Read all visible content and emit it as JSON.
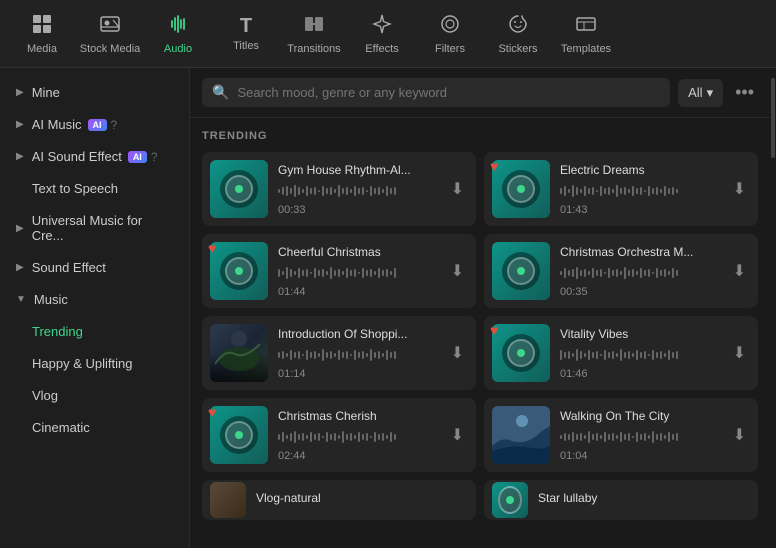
{
  "nav": {
    "items": [
      {
        "id": "media",
        "label": "Media",
        "icon": "⬛",
        "active": false
      },
      {
        "id": "stock-media",
        "label": "Stock Media",
        "icon": "🎬",
        "active": false
      },
      {
        "id": "audio",
        "label": "Audio",
        "icon": "♪",
        "active": true
      },
      {
        "id": "titles",
        "label": "Titles",
        "icon": "T",
        "active": false
      },
      {
        "id": "transitions",
        "label": "Transitions",
        "icon": "▶",
        "active": false
      },
      {
        "id": "effects",
        "label": "Effects",
        "icon": "✦",
        "active": false
      },
      {
        "id": "filters",
        "label": "Filters",
        "icon": "◎",
        "active": false
      },
      {
        "id": "stickers",
        "label": "Stickers",
        "icon": "◈",
        "active": false
      },
      {
        "id": "templates",
        "label": "Templates",
        "icon": "▭",
        "active": false
      }
    ]
  },
  "sidebar": {
    "items": [
      {
        "id": "mine",
        "label": "Mine",
        "indent": false,
        "chevron": "▶",
        "active": false
      },
      {
        "id": "ai-music",
        "label": "AI Music",
        "indent": false,
        "chevron": "▶",
        "badge": "AI",
        "active": false
      },
      {
        "id": "ai-sound-effect",
        "label": "AI Sound Effect",
        "indent": false,
        "chevron": "▶",
        "badge": "AI",
        "active": false
      },
      {
        "id": "text-to-speech",
        "label": "Text to Speech",
        "indent": true,
        "active": false
      },
      {
        "id": "universal-music",
        "label": "Universal Music for Cre...",
        "indent": false,
        "chevron": "▶",
        "active": false
      },
      {
        "id": "sound-effect",
        "label": "Sound Effect",
        "indent": false,
        "chevron": "▶",
        "active": false
      },
      {
        "id": "music",
        "label": "Music",
        "indent": false,
        "chevron": "▼",
        "active": false
      },
      {
        "id": "trending",
        "label": "Trending",
        "indent": true,
        "active": true
      },
      {
        "id": "happy-uplifting",
        "label": "Happy & Uplifting",
        "indent": true,
        "active": false
      },
      {
        "id": "vlog",
        "label": "Vlog",
        "indent": true,
        "active": false
      },
      {
        "id": "cinematic",
        "label": "Cinematic",
        "indent": true,
        "active": false
      }
    ]
  },
  "search": {
    "placeholder": "Search mood, genre or any keyword",
    "filter_label": "All",
    "more_icon": "•••"
  },
  "trending": {
    "section_label": "TRENDING",
    "cards": [
      {
        "id": "gym-house",
        "title": "Gym House Rhythm-Al...",
        "duration": "00:33",
        "thumb_type": "teal",
        "has_heart": false
      },
      {
        "id": "electric-dreams",
        "title": "Electric Dreams",
        "duration": "01:43",
        "thumb_type": "teal",
        "has_heart": true
      },
      {
        "id": "cheerful-christmas",
        "title": "Cheerful Christmas",
        "duration": "01:44",
        "thumb_type": "teal",
        "has_heart": true
      },
      {
        "id": "christmas-orchestra",
        "title": "Christmas Orchestra M...",
        "duration": "00:35",
        "thumb_type": "teal",
        "has_heart": false
      },
      {
        "id": "intro-shopping",
        "title": "Introduction Of Shoppi...",
        "duration": "01:14",
        "thumb_type": "dark-photo",
        "has_heart": false
      },
      {
        "id": "vitality-vibes",
        "title": "Vitality Vibes",
        "duration": "01:46",
        "thumb_type": "teal",
        "has_heart": true
      },
      {
        "id": "christmas-cherish",
        "title": "Christmas Cherish",
        "duration": "02:44",
        "thumb_type": "teal",
        "has_heart": true
      },
      {
        "id": "walking-city",
        "title": "Walking On The City",
        "duration": "01:04",
        "thumb_type": "dark-photo2",
        "has_heart": false
      },
      {
        "id": "vlog-natural",
        "title": "Vlog-natural",
        "duration": "",
        "thumb_type": "photo3",
        "has_heart": false
      },
      {
        "id": "star-lullaby",
        "title": "Star lullaby",
        "duration": "",
        "thumb_type": "teal",
        "has_heart": false
      }
    ]
  },
  "colors": {
    "active_green": "#3dd68c",
    "heart_red": "#e74c3c",
    "bg_main": "#1a1a1a",
    "bg_sidebar": "#1e1e1e",
    "bg_card": "#252525"
  }
}
